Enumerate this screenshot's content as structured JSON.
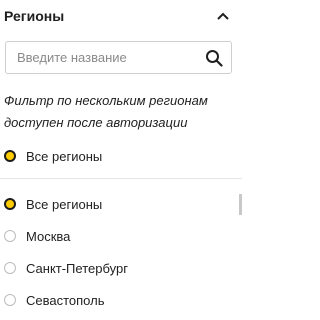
{
  "header": {
    "title": "Регионы",
    "collapse_icon": "chevron-up-icon"
  },
  "search": {
    "placeholder": "Введите название",
    "value": "",
    "icon": "search-icon"
  },
  "notice": {
    "line1": "Фильтр по нескольким регионам",
    "line2": "доступен после авторизации"
  },
  "selected": {
    "label": "Все регионы",
    "checked": true
  },
  "regions": [
    {
      "label": "Все регионы",
      "checked": true
    },
    {
      "label": "Москва",
      "checked": false
    },
    {
      "label": "Санкт-Петербург",
      "checked": false
    },
    {
      "label": "Севастополь",
      "checked": false
    }
  ],
  "colors": {
    "accent": "#ffcc00",
    "radio_border": "#1c1c1c"
  }
}
